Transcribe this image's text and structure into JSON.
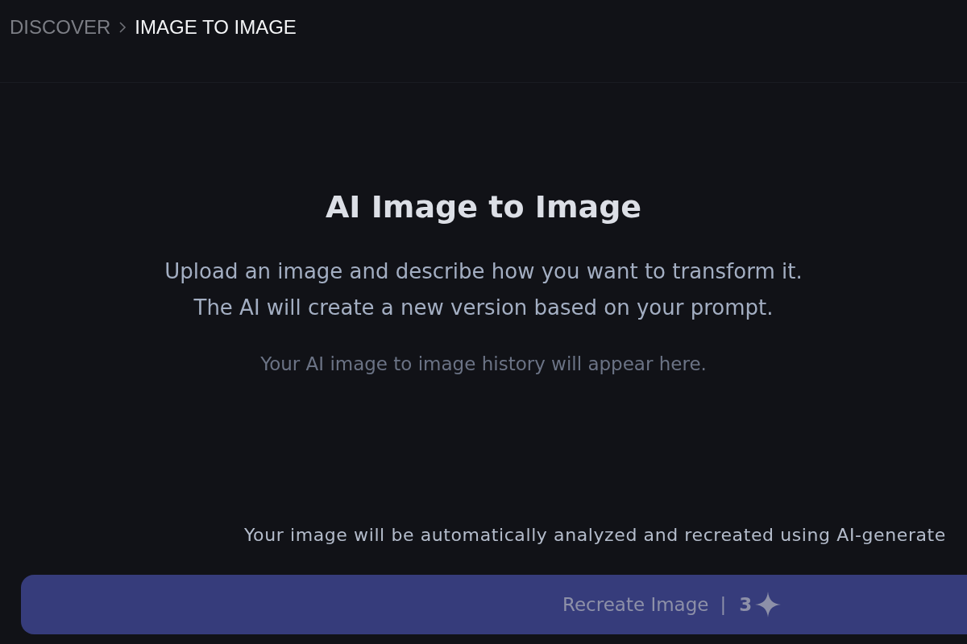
{
  "breadcrumb": [
    {
      "label": "DISCOVER",
      "current": false
    },
    {
      "label": "IMAGE TO IMAGE",
      "current": true
    }
  ],
  "heading": "AI Image to Image",
  "description": [
    "Upload an image and describe how you want to transform it.",
    "The AI will create a new version based on your prompt."
  ],
  "empty_history": "Your AI image to image history will appear here.",
  "notice": "Your image will be automatically analyzed and recreated using AI-generate",
  "submit_button": {
    "label": "Recreate Image",
    "separator": "|",
    "cost": "3",
    "disabled": true
  }
}
